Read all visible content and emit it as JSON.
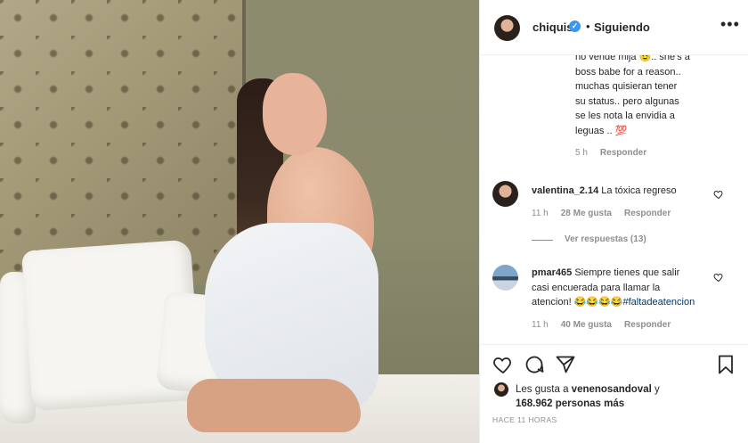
{
  "header": {
    "username": "chiquis",
    "separator": "•",
    "follow_status": "Siguiendo",
    "more_label": "•••"
  },
  "comments": [
    {
      "text_lines": [
        "no vende mija 😉.. she's a",
        "boss babe for a reason..",
        "muchas quisieran tener",
        "su status.. pero algunas",
        "se les nota la envidia a",
        "leguas .. 💯"
      ],
      "age": "5 h",
      "reply_label": "Responder"
    },
    {
      "username": "valentina_2.14",
      "text": "La tóxica regreso",
      "age": "11 h",
      "likes": "28 Me gusta",
      "reply_label": "Responder",
      "view_replies": "Ver respuestas (13)"
    },
    {
      "username": "pmar465",
      "text_line1": "Siempre tienes que salir",
      "text_line2": "casi encuerada para llamar la",
      "text_line3_prefix": "atencion! 😂😂😂😂",
      "hashtag": "#faltadeatencion",
      "age": "11 h",
      "likes": "40 Me gusta",
      "reply_label": "Responder"
    }
  ],
  "likes": {
    "prefix": "Les gusta a",
    "user": "venenosandoval",
    "conjunction": "y",
    "count": "168.962 personas más"
  },
  "timestamp": "HACE 11 HORAS",
  "colors": {
    "verified": "#3897f0",
    "secondary_text": "#8e8e8e",
    "primary_text": "#262626",
    "hashtag": "#00376b"
  }
}
